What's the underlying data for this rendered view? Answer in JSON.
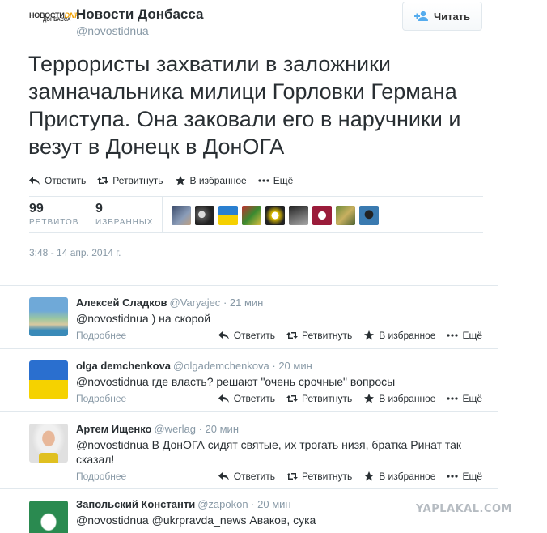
{
  "tweet": {
    "logo_text_1": "НОВОСТИ",
    "logo_text_accent": "DNR",
    "logo_text_2": "ДОНБАССА",
    "author_name": "Новости Донбасса",
    "author_handle": "@novostidnua",
    "follow_label": "Читать",
    "text": "Террористы захватили в заложники замначальника милици Горловки Германа Приступа. Она заковали его в наручники и везут в Донецк в ДонОГА",
    "actions": {
      "reply": "Ответить",
      "retweet": "Ретвитнуть",
      "favorite": "В избранное",
      "more": "Ещё"
    },
    "retweets_count": "99",
    "retweets_label": "РЕТВИТОВ",
    "favorites_count": "9",
    "favorites_label": "ИЗБРАННЫХ",
    "timestamp": "3:48 - 14 апр. 2014 г."
  },
  "replies": [
    {
      "name": "Алексей Сладков",
      "handle": "@Varyajec",
      "time": "· 21 мин",
      "text": "@novostidnua ) на скорой",
      "more": "Подробнее"
    },
    {
      "name": "olga demchenkova",
      "handle": "@olgademchenkova",
      "time": "· 20 мин",
      "text": "@novostidnua где власть? решают \"очень срочные\" вопросы",
      "more": "Подробнее"
    },
    {
      "name": "Артем Ищенко",
      "handle": "@werlag",
      "time": "· 20 мин",
      "text": "@novostidnua В ДонОГА сидят святые, их трогать низя, братка Ринат так сказал!",
      "more": "Подробнее"
    },
    {
      "name": "Запольский Константи",
      "handle": "@zapokon",
      "time": "· 20 мин",
      "text": "@novostidnua @ukrpravda_news Аваков, сука",
      "more": ""
    }
  ],
  "reply_actions": {
    "reply": "Ответить",
    "retweet": "Ретвитнуть",
    "favorite": "В избранное",
    "more": "Ещё"
  },
  "watermark": "YAPLAKAL.COM"
}
